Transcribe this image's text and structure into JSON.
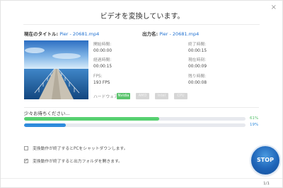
{
  "window": {
    "title": "ビデオを変換しています。",
    "close_glyph": "×"
  },
  "info": {
    "current_title_label": "現在のタイトル:",
    "current_title_value": "Pier - 20681.mp4",
    "output_name_label": "出力名:",
    "output_name_value": "Pier - 20681.mp4"
  },
  "stats": {
    "start_time_label": "開始時間:",
    "start_time_value": "00:00:00",
    "end_time_label": "終了時間:",
    "end_time_value": "00:00:15",
    "elapsed_label": "経過時間:",
    "elapsed_value": "00:00:15",
    "current_time_label": "現在時刻:",
    "current_time_value": "00:00:09",
    "fps_label": "FPS:",
    "fps_value": "193 FPS",
    "remaining_label": "残り時間:",
    "remaining_value": "00:00:08"
  },
  "hardware": {
    "label": "ハードウェア:",
    "options": [
      {
        "name": "Nvidia",
        "active": true
      },
      {
        "name": "AMD",
        "active": false
      },
      {
        "name": "Intel",
        "active": false
      },
      {
        "name": "CPU",
        "active": false
      }
    ]
  },
  "progress": {
    "status": "少々お待ちください...",
    "bar1_percent": 61,
    "bar1_label": "61%",
    "bar2_percent": 19,
    "bar2_label": "19%",
    "bar1_color": "#56d070",
    "bar2_color": "#2f8bdc"
  },
  "options": [
    {
      "label": "変換動作が終了するとPCをシャットダウンします。",
      "checked": false
    },
    {
      "label": "変換動作が終了すると出力フォルダを開きます。",
      "checked": true
    }
  ],
  "stop_label": "STOP",
  "pagination": "1/1",
  "colors": {
    "accent": "#1e6fd0",
    "green": "#56d070",
    "stop": "#1e64b8"
  }
}
